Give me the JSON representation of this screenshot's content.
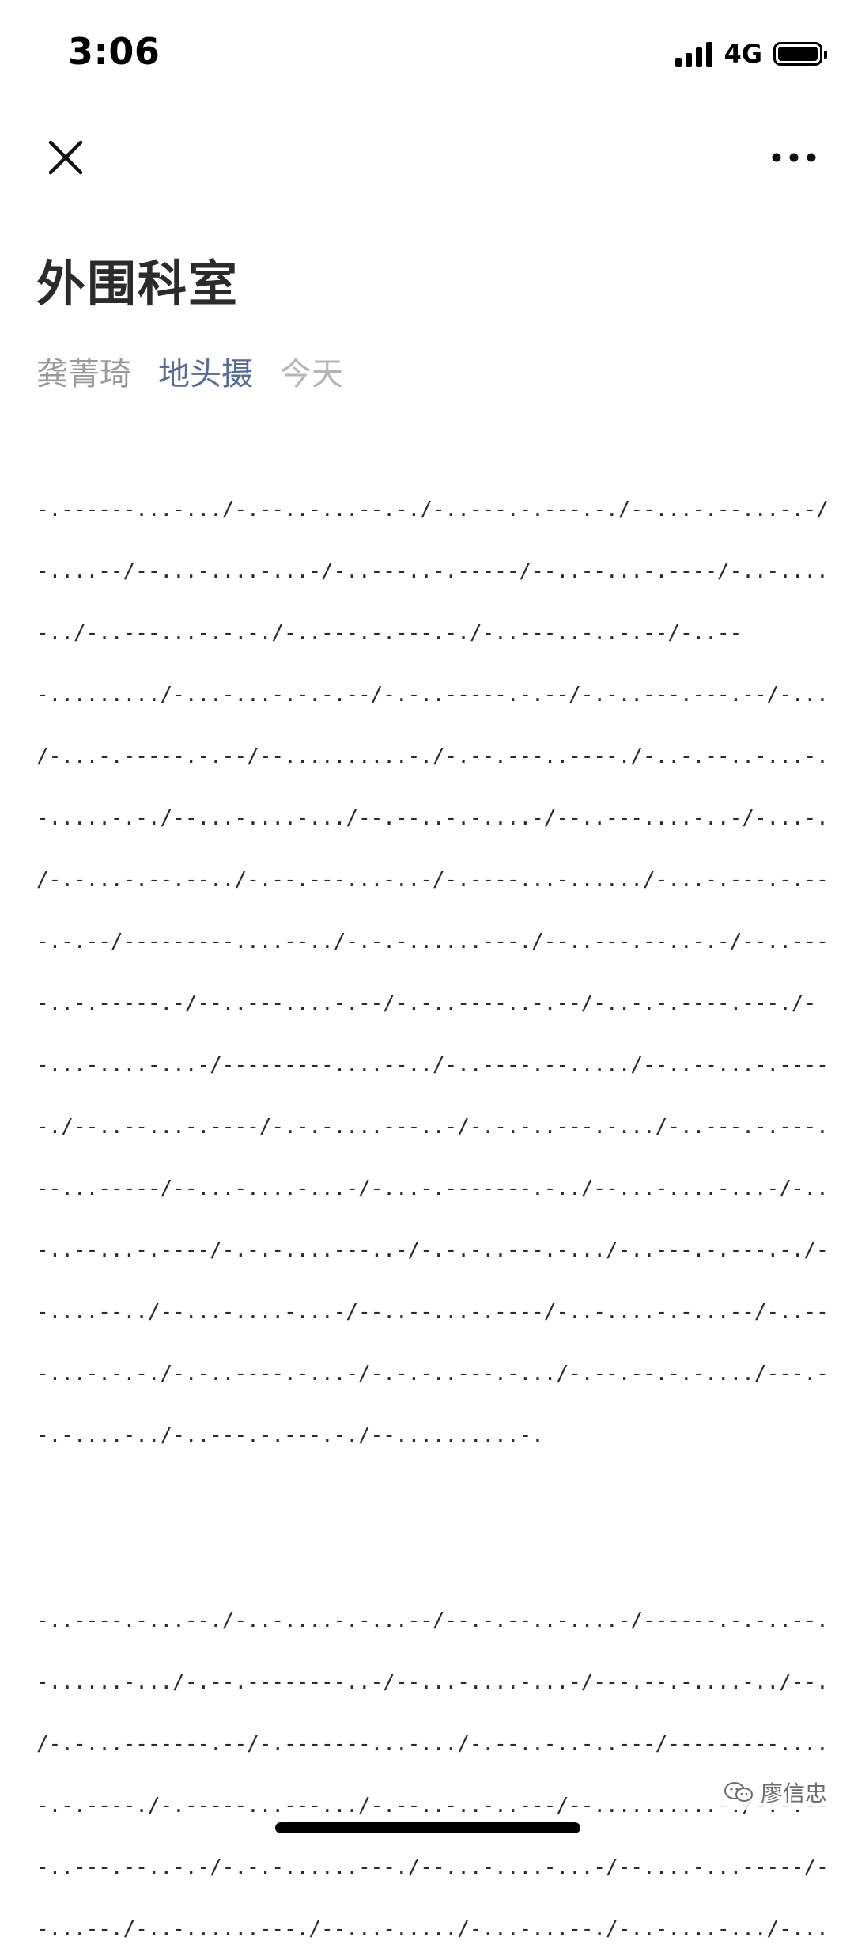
{
  "status_bar": {
    "time": "3:06",
    "network": "4G"
  },
  "nav": {
    "close_icon": "close-icon",
    "more_icon": "more-horizontal-icon"
  },
  "article": {
    "title": "外围科室",
    "author": "龚菁琦",
    "account": "地头摄",
    "date": "今天",
    "paragraphs": [
      [
        "-.------...-.../-.--..-...--.-./-..---.-.---.-./--...-.--...-.-/-.------",
        "-....--/--...-....-...-/-..---..-.-----/--..--...-.----/-..-....-.-...--/--",
        "-../-..---...-.-.-./-..---.-.---.-./-..---..-..-.--/-..--",
        "-........./-...-...-.-.-.--/-.-..-----.-.--/-.-..---.---.--/-...-.---.-.--.-",
        "/-...-.-----.-.--/--..........-./-.--.---..----./-..-.--..-...-.-/-..--",
        "-.....-.-./--...-....-.../--.--..-.-....-/--..---....-..-/-...-...-.-.-.--",
        "/-.-...-.--.--../-.--.---...-..-/-.----...-....../-...-.---.-.--.-/-...-.----",
        "-.-.--/---------....--../-.-.-......---./--..---.--..-.-/--..---....-..-/-.-",
        "-..-.-----.-/--..---....-.--/-.-..----..-.--/-..-.-.----.---./-",
        "-...-....-...-/---------....--../-..----.--...../--..--...-.----/-..---.....-",
        "-./--..--...-.----/-.-.-....---..-/-.-.-..---.-.../-..---.-.---.-./------",
        "--...-----/--...-....-...-/-...-.-------.-../--...-....-...-/-..---.....--.-/-",
        "-..--...-.----/-.-.-....---..-/-.-.-..---.-.../-..---.-.---.-./-------",
        "-....--../--...-....-...-/--..--...-.----/-..-....-.-...--/-..--",
        "-...-.-.-./-.-..----.-...-/-.-.-..---.-.../-.--.--.-.-..../---.-",
        "-.-....-../-..---.-.---.-./--..........-."
      ],
      [
        "-..----.-...--./-..-....-.-...--/--.-.--..-....-/------.-.-..--./-...-",
        "-......-.../-.--.--------..-/--...-....-...-/---.--.-....-../--...-..-.-..--",
        "/-.-...-------.--/-.-------...-.../-.--..-..-..---/---------....--../-..-.--",
        "-.-.----./-.-----...---.../-.--..-..-..---/--..........-./-.-.--.--.----./-",
        "-..---.--..-.-/-.-.-......---./--...-....-...-/--....-...-----/-...-.--",
        "-...--./-..-......---./--...-...../-...-...--./-..-....-.../-...-"
      ]
    ]
  },
  "watermark": {
    "icon": "wechat-official-account-icon",
    "label": "廖信忠"
  }
}
